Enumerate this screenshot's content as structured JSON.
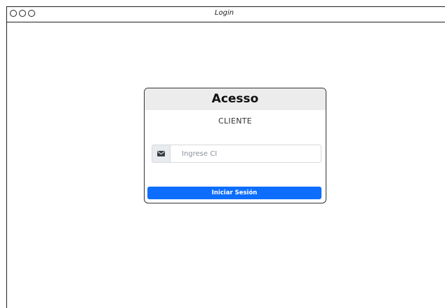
{
  "window": {
    "title": "Login"
  },
  "card": {
    "heading": "Acesso",
    "subtitle": "CLIENTE"
  },
  "ci_field": {
    "icon": "envelope-icon",
    "placeholder": "Ingrese CI",
    "value": ""
  },
  "login_button": {
    "label": "Iniciar Sesión",
    "color": "#0d6efd"
  },
  "colors": {
    "header_bg": "#ececec",
    "addon_bg": "#e9ecef"
  }
}
